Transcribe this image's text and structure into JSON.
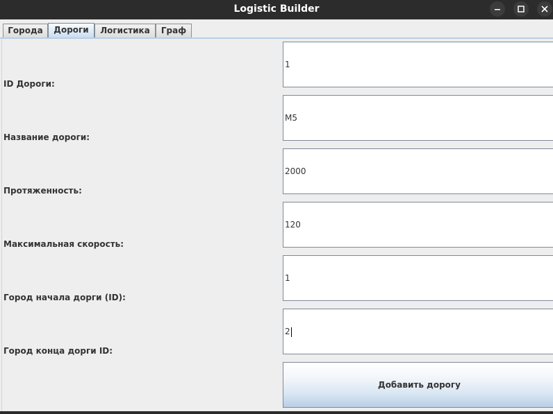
{
  "window": {
    "title": "Logistic Builder",
    "controls": [
      "minimize-icon",
      "maximize-icon",
      "close-icon"
    ]
  },
  "tabs": [
    {
      "label": "Города",
      "active": false
    },
    {
      "label": "Дороги",
      "active": true
    },
    {
      "label": "Логистика",
      "active": false
    },
    {
      "label": "Граф",
      "active": false
    }
  ],
  "form": {
    "fields": [
      {
        "label": "ID Дороги:",
        "value": "1"
      },
      {
        "label": "Название дороги:",
        "value": "M5"
      },
      {
        "label": "Протяженность:",
        "value": "2000"
      },
      {
        "label": "Максимальная скорость:",
        "value": "120"
      },
      {
        "label": "Город начала дорги (ID):",
        "value": "1"
      },
      {
        "label": "Город конца дорги ID:",
        "value": "2"
      }
    ],
    "submit_label": "Добавить дорогу"
  },
  "colors": {
    "titlebar": "#2c2c2c",
    "background": "#eeeeee",
    "accent": "#b8cfe5"
  }
}
